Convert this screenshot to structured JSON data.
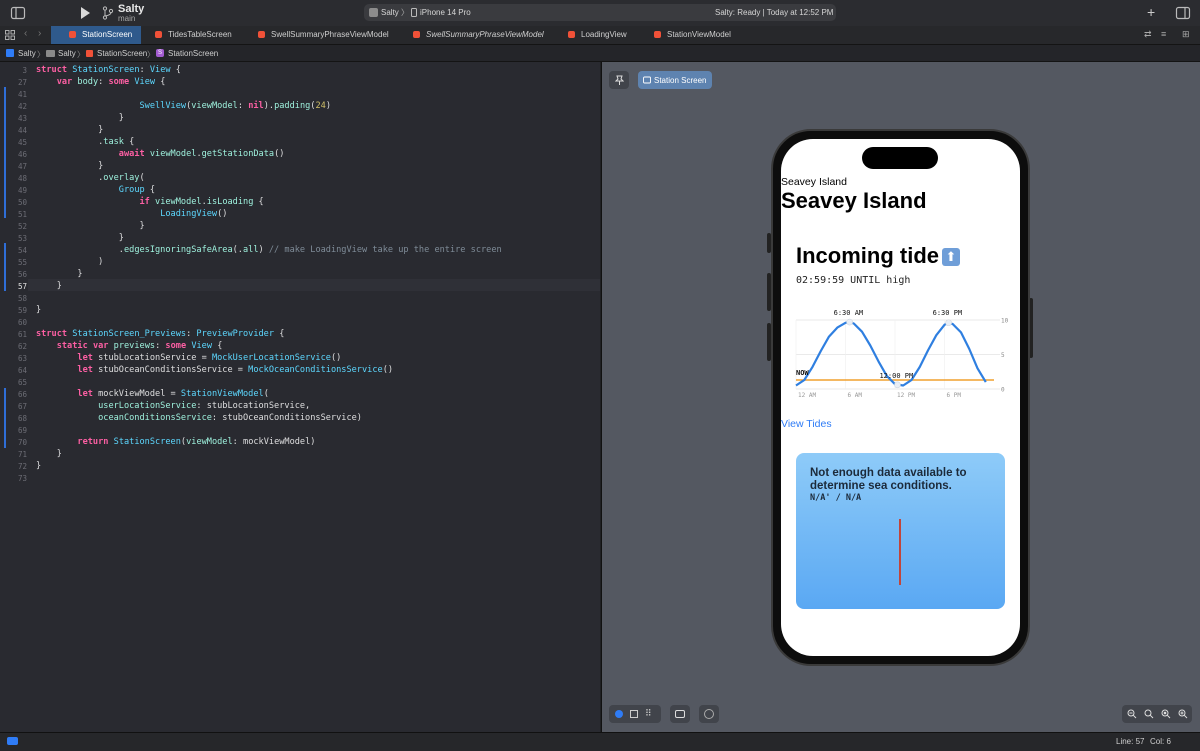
{
  "toolbar": {
    "project": "Salty",
    "branch": "main",
    "scheme": "Salty",
    "device": "iPhone 14 Pro",
    "status": "Salty: Ready | Today at 12:52 PM"
  },
  "tabs": [
    "StationScreen",
    "TidesTableScreen",
    "SwellSummaryPhraseViewModel",
    "SwellSummaryPhraseViewModel",
    "LoadingView",
    "StationViewModel"
  ],
  "breadcrumb": [
    "Salty",
    "Salty",
    "StationScreen",
    "StationScreen"
  ],
  "editor": {
    "current_line": "57",
    "lines": [
      {
        "n": "3",
        "t": "struct StationScreen: View {"
      },
      {
        "n": "27",
        "t": "    var body: some View {"
      },
      {
        "n": "41",
        "t": ""
      },
      {
        "n": "42",
        "t": "                    SwellView(viewModel: nil).padding(24)"
      },
      {
        "n": "43",
        "t": "                }"
      },
      {
        "n": "44",
        "t": "            }"
      },
      {
        "n": "45",
        "t": "            .task {"
      },
      {
        "n": "46",
        "t": "                await viewModel.getStationData()"
      },
      {
        "n": "47",
        "t": "            }"
      },
      {
        "n": "48",
        "t": "            .overlay("
      },
      {
        "n": "49",
        "t": "                Group {"
      },
      {
        "n": "50",
        "t": "                    if viewModel.isLoading {"
      },
      {
        "n": "51",
        "t": "                        LoadingView()"
      },
      {
        "n": "52",
        "t": "                    }"
      },
      {
        "n": "53",
        "t": "                }"
      },
      {
        "n": "54",
        "t": "                .edgesIgnoringSafeArea(.all) // make LoadingView take up the entire screen"
      },
      {
        "n": "55",
        "t": "            )"
      },
      {
        "n": "56",
        "t": "        }"
      },
      {
        "n": "57",
        "t": "    }"
      },
      {
        "n": "58",
        "t": ""
      },
      {
        "n": "59",
        "t": "}"
      },
      {
        "n": "60",
        "t": ""
      },
      {
        "n": "61",
        "t": "struct StationScreen_Previews: PreviewProvider {"
      },
      {
        "n": "62",
        "t": "    static var previews: some View {"
      },
      {
        "n": "63",
        "t": "        let stubLocationService = MockUserLocationService()"
      },
      {
        "n": "64",
        "t": "        let stubOceanConditionsService = MockOceanConditionsService()"
      },
      {
        "n": "65",
        "t": ""
      },
      {
        "n": "66",
        "t": "        let mockViewModel = StationViewModel("
      },
      {
        "n": "67",
        "t": "            userLocationService: stubLocationService,"
      },
      {
        "n": "68",
        "t": "            oceanConditionsService: stubOceanConditionsService)"
      },
      {
        "n": "69",
        "t": ""
      },
      {
        "n": "70",
        "t": "        return StationScreen(viewModel: mockViewModel)"
      },
      {
        "n": "71",
        "t": "    }"
      },
      {
        "n": "72",
        "t": "}"
      },
      {
        "n": "73",
        "t": ""
      }
    ]
  },
  "preview": {
    "tab_label": "Station Screen",
    "station_small": "Seavey Island",
    "station_large": "Seavey Island",
    "tide_title": "Incoming tide",
    "tide_arrow": "⬆",
    "tide_until": "02:59:59 UNTIL high",
    "view_tides": "View Tides",
    "card_message": "Not enough data available to determine sea conditions.",
    "card_value": "N/A' / N/A"
  },
  "chart_data": {
    "type": "line",
    "x_ticks": [
      "12 AM",
      "6 AM",
      "12 PM",
      "6 PM"
    ],
    "y_ticks": [
      "10",
      "5",
      "0"
    ],
    "ylim": [
      0,
      10
    ],
    "annotations": [
      "6:30 AM",
      "12:00 PM",
      "6:30 PM",
      "NOW"
    ],
    "series": [
      {
        "x": [
          0,
          1,
          2,
          3,
          4,
          5,
          6,
          6.5,
          7,
          8,
          9,
          10,
          11,
          12,
          13,
          14,
          15,
          16,
          17,
          18,
          18.5,
          19,
          20,
          21,
          22,
          23
        ],
        "values": [
          0.5,
          1.3,
          3.2,
          5.5,
          7.6,
          8.9,
          9.6,
          9.7,
          9.5,
          8.3,
          6.3,
          4.0,
          1.9,
          0.7,
          0.5,
          1.3,
          3.2,
          5.6,
          7.8,
          9.3,
          9.6,
          9.4,
          8.2,
          5.8,
          3.0,
          1.0
        ]
      }
    ],
    "reference_line": 1.3
  },
  "statusbar": {
    "line": "Line: 57",
    "col": "Col: 6"
  }
}
